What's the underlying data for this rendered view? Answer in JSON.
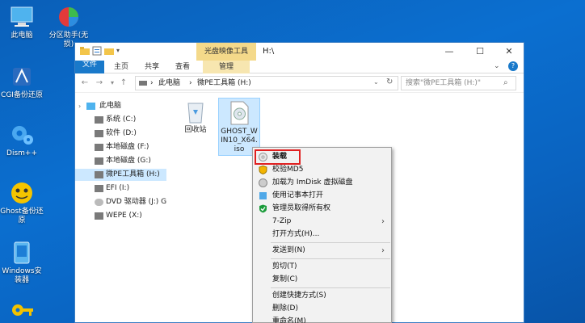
{
  "desktop": {
    "icons": [
      {
        "label": "此电脑"
      },
      {
        "label": "分区助手(无损)"
      },
      {
        "label": "CGI备份还原"
      },
      {
        "label": "Dism++"
      },
      {
        "label": "Ghost备份还原"
      },
      {
        "label": "Windows安装器"
      }
    ]
  },
  "window": {
    "context_tab_header": "光盘映像工具",
    "title": "H:\\",
    "controls": {
      "minimize": "—",
      "maximize": "☐",
      "close": "✕"
    },
    "ribbon_tabs": [
      "文件",
      "主页",
      "共享",
      "查看",
      "管理"
    ],
    "address": {
      "crumb1": "此电脑",
      "crumb2": "微PE工具箱 (H:)",
      "sep": "›"
    },
    "search_placeholder": "搜索\"微PE工具箱 (H:)\"",
    "nav_tree": [
      {
        "label": "此电脑"
      },
      {
        "label": "系统 (C:)"
      },
      {
        "label": "软件 (D:)"
      },
      {
        "label": "本地磁盘 (F:)"
      },
      {
        "label": "本地磁盘 (G:)"
      },
      {
        "label": "微PE工具箱 (H:)"
      },
      {
        "label": "EFI (I:)"
      },
      {
        "label": "DVD 驱动器 (J:) Gh"
      },
      {
        "label": "WEPE (X:)"
      }
    ],
    "files": [
      {
        "label": "回收站"
      },
      {
        "label": "GHOST_WIN10_X64.iso"
      }
    ]
  },
  "context_menu": {
    "items": [
      {
        "label": "装载",
        "bold": true
      },
      {
        "label": "校验MD5"
      },
      {
        "label": "加载为 ImDisk 虚拟磁盘"
      },
      {
        "label": "使用记事本打开"
      },
      {
        "label": "管理员取得所有权"
      },
      {
        "label": "7-Zip"
      },
      {
        "label": "打开方式(H)..."
      },
      {
        "label": "发送到(N)"
      },
      {
        "label": "剪切(T)"
      },
      {
        "label": "复制(C)"
      },
      {
        "label": "创建快捷方式(S)"
      },
      {
        "label": "删除(D)"
      },
      {
        "label": "重命名(M)"
      }
    ]
  },
  "colors": {
    "accent": "#1979ca",
    "highlight": "#e02020",
    "selection": "#cce8ff"
  }
}
